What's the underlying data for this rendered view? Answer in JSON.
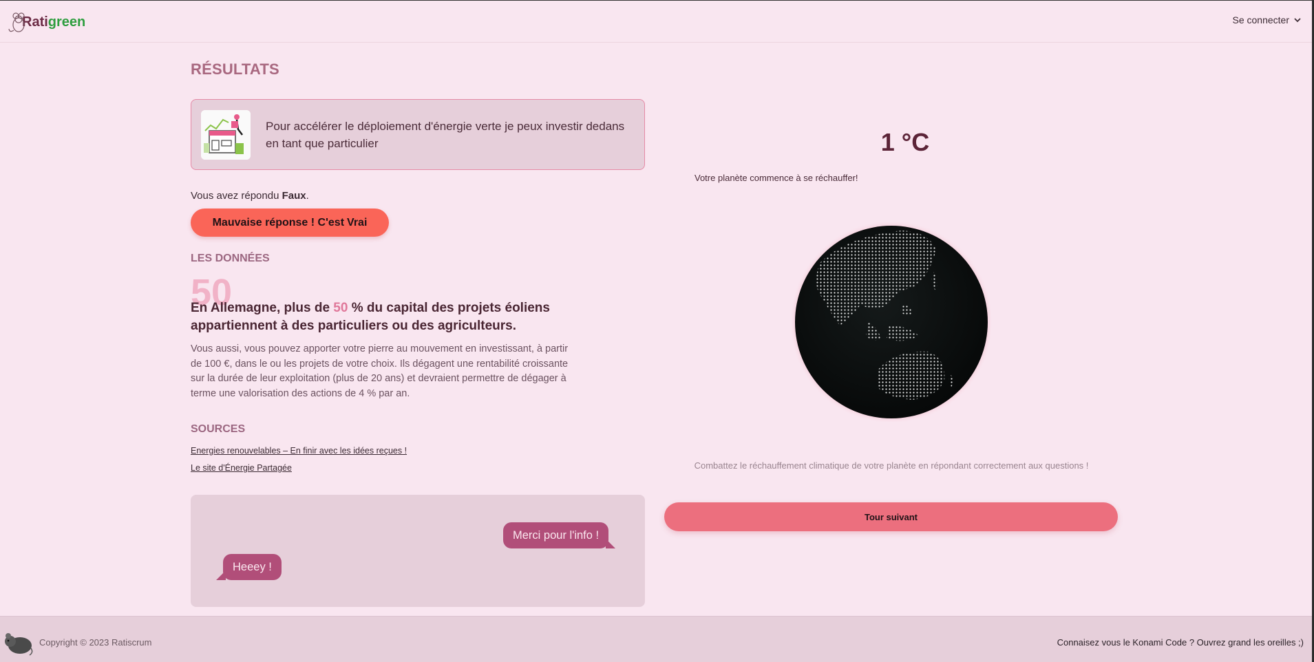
{
  "header": {
    "logo_part1": "Rati",
    "logo_part2": "green",
    "login_label": "Se connecter"
  },
  "page_title": "RÉSULTATS",
  "question": {
    "text": "Pour accélérer le déploiement d'énergie verte je peux investir dedans en tant que particulier"
  },
  "answer": {
    "prefix": "Vous avez répondu",
    "given": "Faux",
    "suffix": ".",
    "result_label": "Mauvaise réponse ! C'est",
    "correct": "Vrai"
  },
  "data_section": {
    "title": "LES DONNÉES",
    "big_number": "50",
    "fact_before": "En Allemagne, plus de",
    "fact_number": "50",
    "fact_after": "% du capital des projets éoliens appartiennent à des particuliers ou des agriculteurs.",
    "description": "Vous aussi, vous pouvez apporter votre pierre au mouvement en investissant, à partir de 100 €, dans le ou les projets de votre choix. Ils dégagent une rentabilité croissante sur la durée de leur exploitation (plus de 20 ans) et devraient permettre de dégager à terme une valorisation des actions de 4 % par an."
  },
  "sources": {
    "title": "SOURCES",
    "links": [
      "Energies renouvelables – En finir avec les idées reçues !",
      "Le site d'Énergie Partagée"
    ]
  },
  "chat": {
    "message_right": "Merci pour l'info !",
    "message_left": "Heeey !"
  },
  "climate": {
    "temperature": "1 °C",
    "planet_message": "Votre planète commence à se réchauffer!",
    "combat_message": "Combattez le réchauffement climatique de votre planète en répondant correctement aux questions !",
    "next_button": "Tour suivant"
  },
  "footer": {
    "copyright": "Copyright © 2023 Ratiscrum",
    "konami": "Connaisez vous le Konami Code ? Ouvrez grand les oreilles ;)"
  },
  "colors": {
    "background": "#f9e6f0",
    "accent_red": "#fa6558",
    "next_button": "#ec6f7e",
    "bubble": "#b14e79",
    "logo_green": "#2e9e3f"
  }
}
